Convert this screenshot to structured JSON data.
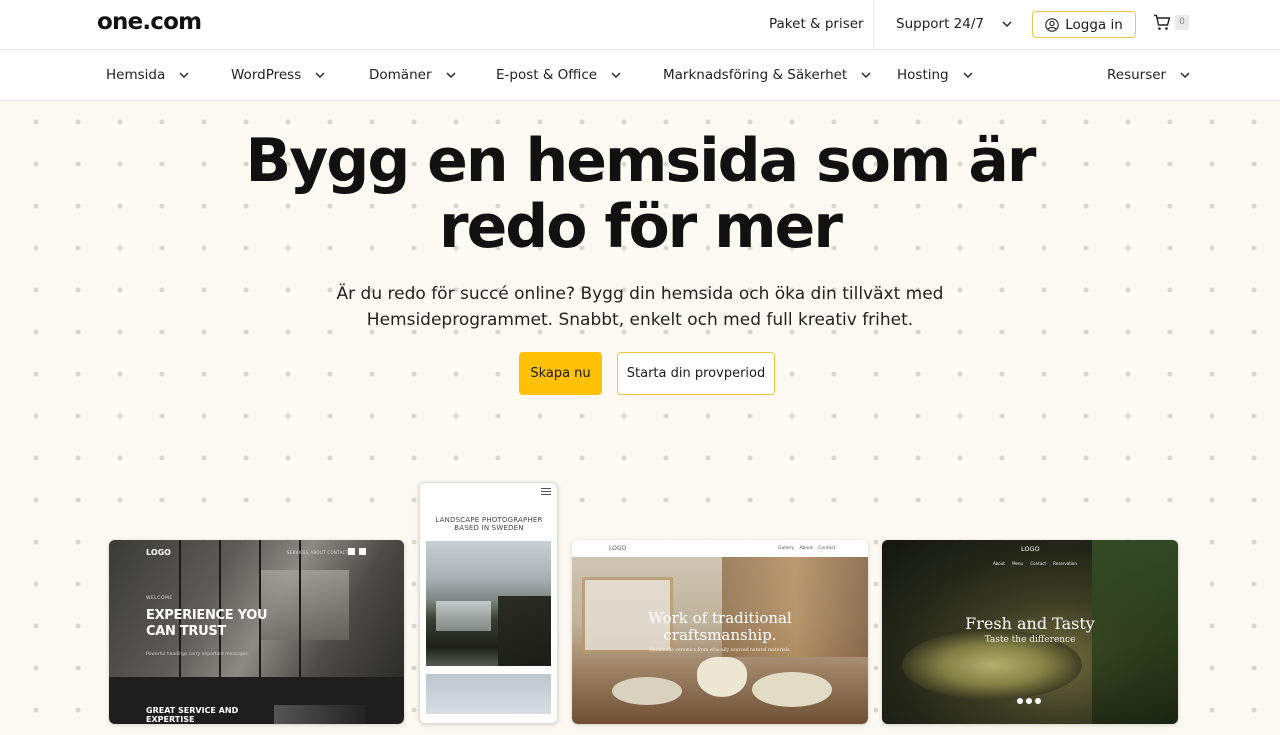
{
  "header": {
    "logo": "one.com",
    "pricing_link": "Paket & priser",
    "support_link": "Support 24/7",
    "login_label": "Logga in",
    "cart_count": "0"
  },
  "nav": {
    "items": [
      {
        "label": "Hemsida"
      },
      {
        "label": "WordPress"
      },
      {
        "label": "Domäner"
      },
      {
        "label": "E-post & Office"
      },
      {
        "label": "Marknadsföring & Säkerhet"
      },
      {
        "label": "Hosting"
      },
      {
        "label": "Resurser"
      }
    ]
  },
  "hero": {
    "title_line1": "Bygg en hemsida som är",
    "title_line2": "redo för mer",
    "subtitle_line1": "Är du redo för succé online? Bygg din hemsida och öka din tillväxt med",
    "subtitle_line2": "Hemsideprogrammet. Snabbt, enkelt och med full kreativ frihet.",
    "primary_button": "Skapa nu",
    "secondary_button": "Starta din provperiod"
  },
  "previews": {
    "card1": {
      "logo": "LOGO",
      "menu": "SERVICES   ABOUT   CONTACT",
      "welcome": "WELCOME",
      "headline": "EXPERIENCE YOU CAN TRUST",
      "small": "Powerful headings carry important messages.",
      "bottom": "GREAT SERVICE AND EXPERTISE"
    },
    "card2": {
      "heading": "LANDSCAPE PHOTOGRAPHER BASED IN SWEDEN"
    },
    "card3": {
      "logo": "LOGO",
      "nav": "Gallery About Contact",
      "title": "Work of traditional craftsmanship.",
      "subtitle": "Handmade ceramics from ethically sourced natural materials."
    },
    "card4": {
      "logo": "LOGO",
      "nav": "About Menu Contact Reservation",
      "title": "Fresh and Tasty",
      "subtitle": "Taste the difference"
    }
  },
  "colors": {
    "accent": "#ffc107",
    "accent_border": "#f0c445",
    "background": "#fcfaf2"
  }
}
